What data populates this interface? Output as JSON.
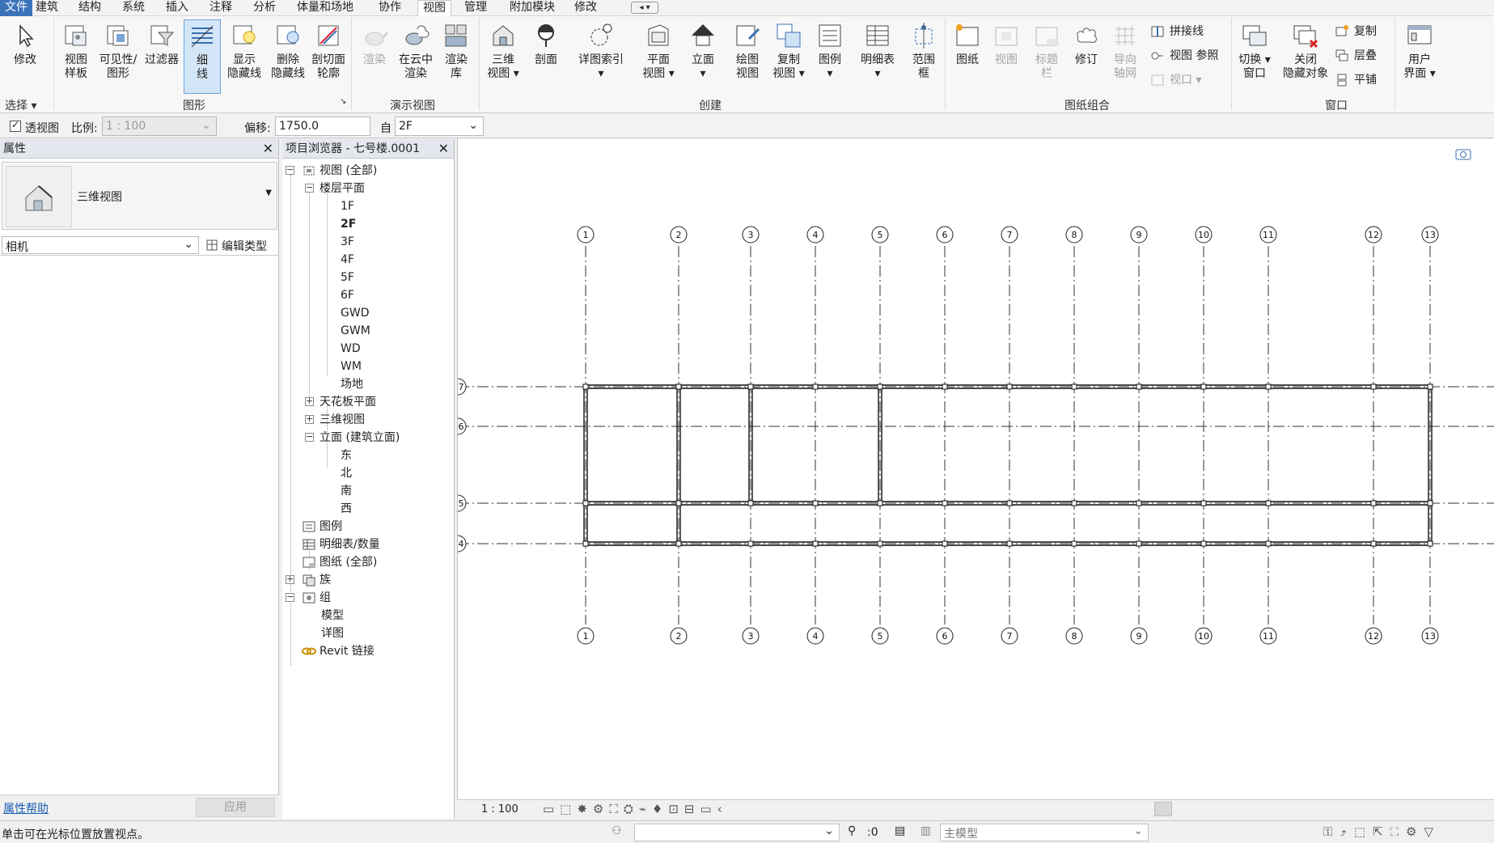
{
  "menu": {
    "items": [
      "文件",
      "建筑",
      "结构",
      "系统",
      "插入",
      "注释",
      "分析",
      "体量和场地",
      "协作",
      "视图",
      "管理",
      "附加模块",
      "修改"
    ],
    "active": "视图"
  },
  "ribbon": {
    "select_label": "选择",
    "groups": {
      "graphics": "图形",
      "presentation": "演示视图",
      "create": "创建",
      "sheet": "图纸组合",
      "window": "窗口"
    },
    "buttons": {
      "modify": "修改",
      "view_template_1": "视图",
      "view_template_2": "样板",
      "visibility_1": "可见性/",
      "visibility_2": "图形",
      "filters": "过滤器",
      "thin_1": "细",
      "thin_2": "线",
      "show_hidden_1": "显示",
      "show_hidden_2": "隐藏线",
      "remove_hidden_1": "删除",
      "remove_hidden_2": "隐藏线",
      "cut_profile_1": "剖切面",
      "cut_profile_2": "轮廓",
      "render": "渲染",
      "cloud_render_1": "在云中",
      "cloud_render_2": "渲染",
      "render_gallery_1": "渲染",
      "render_gallery_2": "库",
      "view3d_1": "三维",
      "view3d_2": "视图",
      "section": "剖面",
      "callout": "详图索引",
      "plan_1": "平面",
      "plan_2": "视图",
      "elevation": "立面",
      "drafting_1": "绘图",
      "drafting_2": "视图",
      "duplicate_1": "复制",
      "duplicate_2": "视图",
      "legend": "图例",
      "schedule": "明细表",
      "scope_1": "范围",
      "scope_2": "框",
      "sheet": "图纸",
      "view": "视图",
      "titleblock_1": "标题",
      "titleblock_2": "栏",
      "revision": "修订",
      "guidegrid_1": "导向",
      "guidegrid_2": "轴网",
      "matchline": "拼接线",
      "viewref": "视图 参照",
      "viewport": "视口",
      "switch_1": "切换",
      "switch_2": "窗口",
      "close_hidden_1": "关闭",
      "close_hidden_2": "隐藏对象",
      "replicate": "复制",
      "cascade": "层叠",
      "tile": "平铺",
      "ui_1": "用户",
      "ui_2": "界面"
    }
  },
  "optbar": {
    "perspective": "透视图",
    "scale_label": "比例:",
    "scale_value": "1 : 100",
    "offset_label": "偏移:",
    "offset_value": "1750.0",
    "from_label": "自",
    "from_value": "2F"
  },
  "properties": {
    "title": "属性",
    "type_name": "三维视图",
    "category": "相机",
    "edit_type": "编辑类型",
    "help": "属性帮助",
    "apply": "应用"
  },
  "browser": {
    "title": "项目浏览器 - 七号楼.0001",
    "nodes": {
      "views": "视图 (全部)",
      "floor_plans": "楼层平面",
      "f1": "1F",
      "f2": "2F",
      "f3": "3F",
      "f4": "4F",
      "f5": "5F",
      "f6": "6F",
      "gwd": "GWD",
      "gwm": "GWM",
      "wd": "WD",
      "wm": "WM",
      "site": "场地",
      "ceiling": "天花板平面",
      "views3d": "三维视图",
      "elevations": "立面 (建筑立面)",
      "east": "东",
      "north": "北",
      "south": "南",
      "west": "西",
      "legends": "图例",
      "schedules": "明细表/数量",
      "sheets": "图纸 (全部)",
      "families": "族",
      "groups": "组",
      "model": "模型",
      "detail": "详图",
      "links": "Revit 链接"
    }
  },
  "canvas": {
    "grid_x": [
      "1",
      "2",
      "3",
      "4",
      "5",
      "6",
      "7",
      "8",
      "9",
      "10",
      "11",
      "12",
      "13"
    ],
    "grid_y": [
      "7",
      "6",
      "5",
      "4"
    ]
  },
  "viewctrl": {
    "scale": "1 : 100"
  },
  "status": {
    "message": "单击可在光标位置放置视点。",
    "selection_count": ":0",
    "model": "主模型"
  }
}
